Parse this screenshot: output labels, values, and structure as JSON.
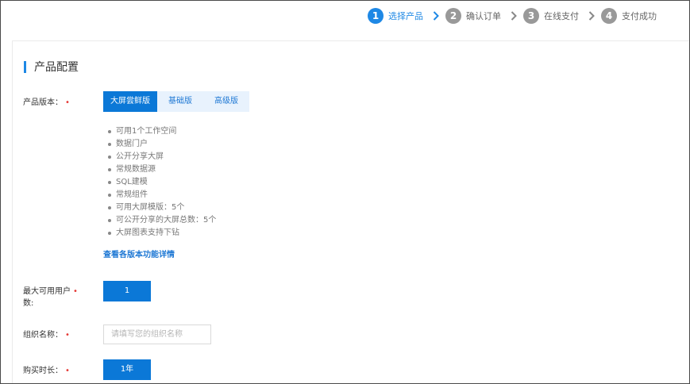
{
  "stepper": {
    "steps": [
      {
        "num": "1",
        "label": "选择产品"
      },
      {
        "num": "2",
        "label": "确认订单"
      },
      {
        "num": "3",
        "label": "在线支付"
      },
      {
        "num": "4",
        "label": "支付成功"
      }
    ],
    "active_index": 0
  },
  "section": {
    "title": "产品配置"
  },
  "form": {
    "version": {
      "label": "产品版本：",
      "required_mark": "•",
      "options": [
        "大屏尝鲜版",
        "基础版",
        "高级版"
      ],
      "selected": "大屏尝鲜版"
    },
    "features": [
      "可用1个工作空间",
      "数据门户",
      "公开分享大屏",
      "常规数据源",
      "SQL建模",
      "常规组件",
      "可用大屏模版：5个",
      "可公开分享的大屏总数：5个",
      "大屏图表支持下钻"
    ],
    "details_link": "查看各版本功能详情",
    "max_users": {
      "label_line1": "最大可用用户",
      "label_line2": "数:",
      "required_mark": "•",
      "value": "1"
    },
    "org_name": {
      "label": "组织名称：",
      "required_mark": "•",
      "placeholder": "请填写您的组织名称",
      "value": ""
    },
    "duration": {
      "label": "购买时长：",
      "required_mark": "•",
      "value": "1年"
    }
  },
  "colors": {
    "accent": "#0b78d7",
    "step_active": "#1e88e5",
    "step_inactive": "#999999",
    "required": "#e53935"
  }
}
